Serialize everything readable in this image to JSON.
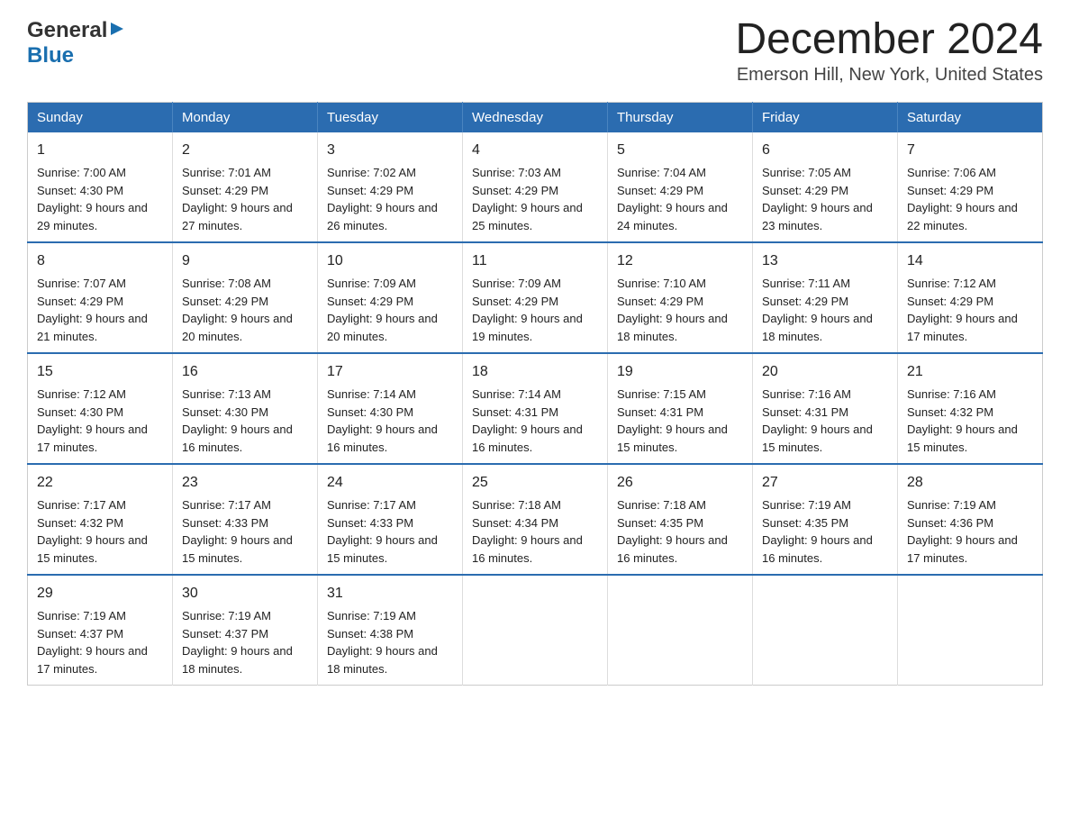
{
  "header": {
    "logo": {
      "general": "General",
      "blue": "Blue",
      "arrow": "▶"
    },
    "title": "December 2024",
    "location": "Emerson Hill, New York, United States"
  },
  "calendar": {
    "days_of_week": [
      "Sunday",
      "Monday",
      "Tuesday",
      "Wednesday",
      "Thursday",
      "Friday",
      "Saturday"
    ],
    "weeks": [
      [
        {
          "day": "1",
          "sunrise": "Sunrise: 7:00 AM",
          "sunset": "Sunset: 4:30 PM",
          "daylight": "Daylight: 9 hours and 29 minutes."
        },
        {
          "day": "2",
          "sunrise": "Sunrise: 7:01 AM",
          "sunset": "Sunset: 4:29 PM",
          "daylight": "Daylight: 9 hours and 27 minutes."
        },
        {
          "day": "3",
          "sunrise": "Sunrise: 7:02 AM",
          "sunset": "Sunset: 4:29 PM",
          "daylight": "Daylight: 9 hours and 26 minutes."
        },
        {
          "day": "4",
          "sunrise": "Sunrise: 7:03 AM",
          "sunset": "Sunset: 4:29 PM",
          "daylight": "Daylight: 9 hours and 25 minutes."
        },
        {
          "day": "5",
          "sunrise": "Sunrise: 7:04 AM",
          "sunset": "Sunset: 4:29 PM",
          "daylight": "Daylight: 9 hours and 24 minutes."
        },
        {
          "day": "6",
          "sunrise": "Sunrise: 7:05 AM",
          "sunset": "Sunset: 4:29 PM",
          "daylight": "Daylight: 9 hours and 23 minutes."
        },
        {
          "day": "7",
          "sunrise": "Sunrise: 7:06 AM",
          "sunset": "Sunset: 4:29 PM",
          "daylight": "Daylight: 9 hours and 22 minutes."
        }
      ],
      [
        {
          "day": "8",
          "sunrise": "Sunrise: 7:07 AM",
          "sunset": "Sunset: 4:29 PM",
          "daylight": "Daylight: 9 hours and 21 minutes."
        },
        {
          "day": "9",
          "sunrise": "Sunrise: 7:08 AM",
          "sunset": "Sunset: 4:29 PM",
          "daylight": "Daylight: 9 hours and 20 minutes."
        },
        {
          "day": "10",
          "sunrise": "Sunrise: 7:09 AM",
          "sunset": "Sunset: 4:29 PM",
          "daylight": "Daylight: 9 hours and 20 minutes."
        },
        {
          "day": "11",
          "sunrise": "Sunrise: 7:09 AM",
          "sunset": "Sunset: 4:29 PM",
          "daylight": "Daylight: 9 hours and 19 minutes."
        },
        {
          "day": "12",
          "sunrise": "Sunrise: 7:10 AM",
          "sunset": "Sunset: 4:29 PM",
          "daylight": "Daylight: 9 hours and 18 minutes."
        },
        {
          "day": "13",
          "sunrise": "Sunrise: 7:11 AM",
          "sunset": "Sunset: 4:29 PM",
          "daylight": "Daylight: 9 hours and 18 minutes."
        },
        {
          "day": "14",
          "sunrise": "Sunrise: 7:12 AM",
          "sunset": "Sunset: 4:29 PM",
          "daylight": "Daylight: 9 hours and 17 minutes."
        }
      ],
      [
        {
          "day": "15",
          "sunrise": "Sunrise: 7:12 AM",
          "sunset": "Sunset: 4:30 PM",
          "daylight": "Daylight: 9 hours and 17 minutes."
        },
        {
          "day": "16",
          "sunrise": "Sunrise: 7:13 AM",
          "sunset": "Sunset: 4:30 PM",
          "daylight": "Daylight: 9 hours and 16 minutes."
        },
        {
          "day": "17",
          "sunrise": "Sunrise: 7:14 AM",
          "sunset": "Sunset: 4:30 PM",
          "daylight": "Daylight: 9 hours and 16 minutes."
        },
        {
          "day": "18",
          "sunrise": "Sunrise: 7:14 AM",
          "sunset": "Sunset: 4:31 PM",
          "daylight": "Daylight: 9 hours and 16 minutes."
        },
        {
          "day": "19",
          "sunrise": "Sunrise: 7:15 AM",
          "sunset": "Sunset: 4:31 PM",
          "daylight": "Daylight: 9 hours and 15 minutes."
        },
        {
          "day": "20",
          "sunrise": "Sunrise: 7:16 AM",
          "sunset": "Sunset: 4:31 PM",
          "daylight": "Daylight: 9 hours and 15 minutes."
        },
        {
          "day": "21",
          "sunrise": "Sunrise: 7:16 AM",
          "sunset": "Sunset: 4:32 PM",
          "daylight": "Daylight: 9 hours and 15 minutes."
        }
      ],
      [
        {
          "day": "22",
          "sunrise": "Sunrise: 7:17 AM",
          "sunset": "Sunset: 4:32 PM",
          "daylight": "Daylight: 9 hours and 15 minutes."
        },
        {
          "day": "23",
          "sunrise": "Sunrise: 7:17 AM",
          "sunset": "Sunset: 4:33 PM",
          "daylight": "Daylight: 9 hours and 15 minutes."
        },
        {
          "day": "24",
          "sunrise": "Sunrise: 7:17 AM",
          "sunset": "Sunset: 4:33 PM",
          "daylight": "Daylight: 9 hours and 15 minutes."
        },
        {
          "day": "25",
          "sunrise": "Sunrise: 7:18 AM",
          "sunset": "Sunset: 4:34 PM",
          "daylight": "Daylight: 9 hours and 16 minutes."
        },
        {
          "day": "26",
          "sunrise": "Sunrise: 7:18 AM",
          "sunset": "Sunset: 4:35 PM",
          "daylight": "Daylight: 9 hours and 16 minutes."
        },
        {
          "day": "27",
          "sunrise": "Sunrise: 7:19 AM",
          "sunset": "Sunset: 4:35 PM",
          "daylight": "Daylight: 9 hours and 16 minutes."
        },
        {
          "day": "28",
          "sunrise": "Sunrise: 7:19 AM",
          "sunset": "Sunset: 4:36 PM",
          "daylight": "Daylight: 9 hours and 17 minutes."
        }
      ],
      [
        {
          "day": "29",
          "sunrise": "Sunrise: 7:19 AM",
          "sunset": "Sunset: 4:37 PM",
          "daylight": "Daylight: 9 hours and 17 minutes."
        },
        {
          "day": "30",
          "sunrise": "Sunrise: 7:19 AM",
          "sunset": "Sunset: 4:37 PM",
          "daylight": "Daylight: 9 hours and 18 minutes."
        },
        {
          "day": "31",
          "sunrise": "Sunrise: 7:19 AM",
          "sunset": "Sunset: 4:38 PM",
          "daylight": "Daylight: 9 hours and 18 minutes."
        },
        null,
        null,
        null,
        null
      ]
    ]
  }
}
